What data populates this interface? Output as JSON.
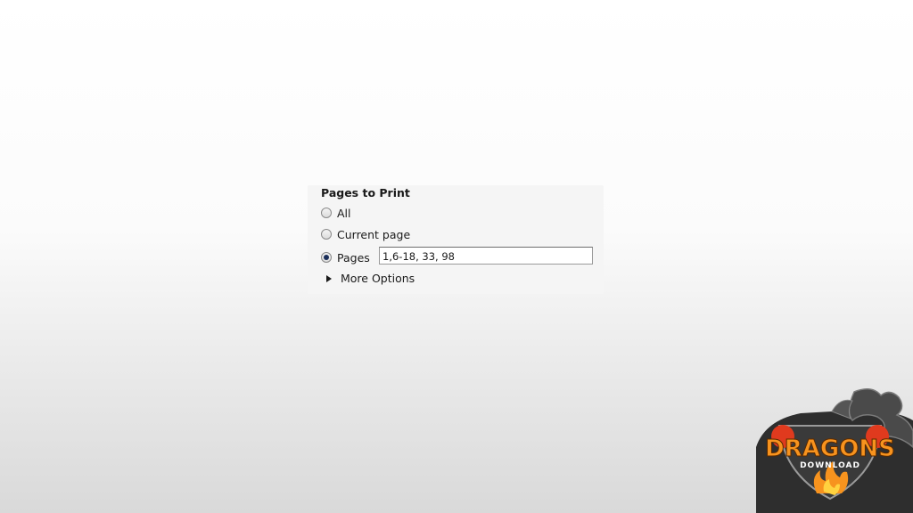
{
  "pages_to_print": {
    "title": "Pages to Print",
    "options": [
      {
        "label": "All",
        "selected": false
      },
      {
        "label": "Current page",
        "selected": false
      },
      {
        "label": "Pages",
        "selected": true
      }
    ],
    "pages_input_value": "1,6-18, 33, 98",
    "more_options_label": "More Options"
  },
  "watermark": {
    "brand_text": "DRAGONS",
    "sub_text": "DOWNLOAD",
    "icon": "dragon-shield-logo"
  },
  "colors": {
    "radio_dot": "#1b2f5a",
    "logo_orange": "#f7931e",
    "logo_dark": "#2a2a2a"
  }
}
